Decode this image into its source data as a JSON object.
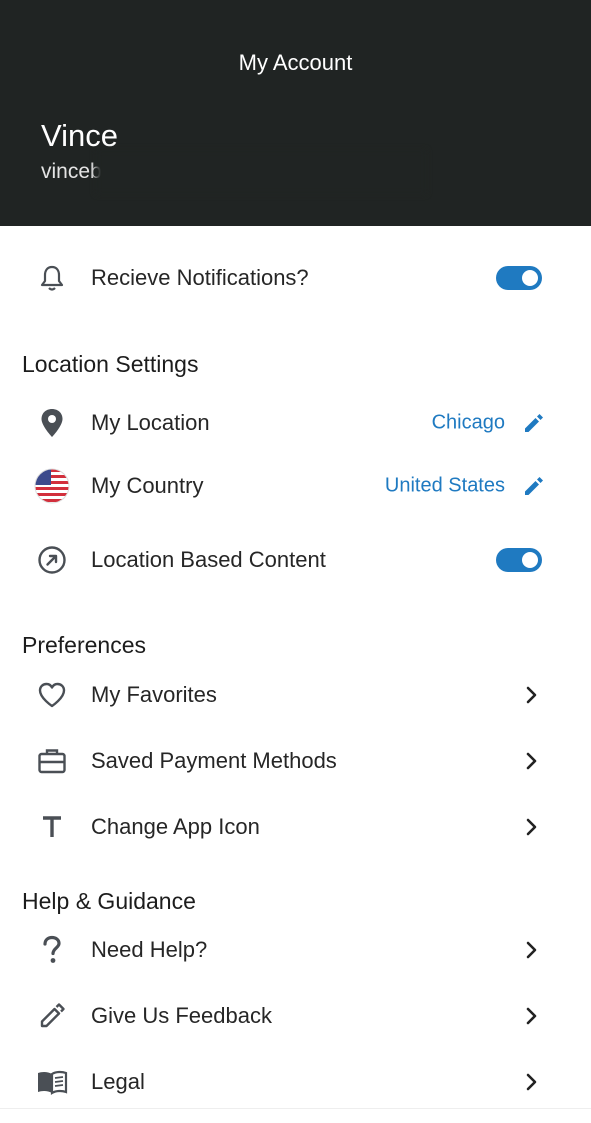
{
  "header": {
    "title": "My Account",
    "user_name": "Vince",
    "user_email": "vinceb"
  },
  "notifications": {
    "label": "Recieve Notifications?",
    "enabled": true,
    "icon": "bell-icon"
  },
  "location_settings": {
    "title": "Location Settings",
    "my_location": {
      "label": "My Location",
      "value": "Chicago",
      "icon": "location-pin-icon"
    },
    "my_country": {
      "label": "My Country",
      "value": "United States",
      "icon": "us-flag-icon"
    },
    "location_based_content": {
      "label": "Location Based Content",
      "enabled": true,
      "icon": "compass-arrow-icon"
    }
  },
  "preferences": {
    "title": "Preferences",
    "items": [
      {
        "label": "My Favorites",
        "icon": "heart-icon"
      },
      {
        "label": "Saved Payment Methods",
        "icon": "briefcase-icon"
      },
      {
        "label": "Change App Icon",
        "icon": "text-t-icon"
      }
    ]
  },
  "help": {
    "title": "Help & Guidance",
    "items": [
      {
        "label": "Need Help?",
        "icon": "question-icon"
      },
      {
        "label": "Give Us Feedback",
        "icon": "pencil-icon"
      },
      {
        "label": "Legal",
        "icon": "book-icon"
      }
    ]
  },
  "colors": {
    "header_bg": "#202423",
    "accent": "#1f7ac1",
    "icon_gray": "#4a4f55"
  }
}
